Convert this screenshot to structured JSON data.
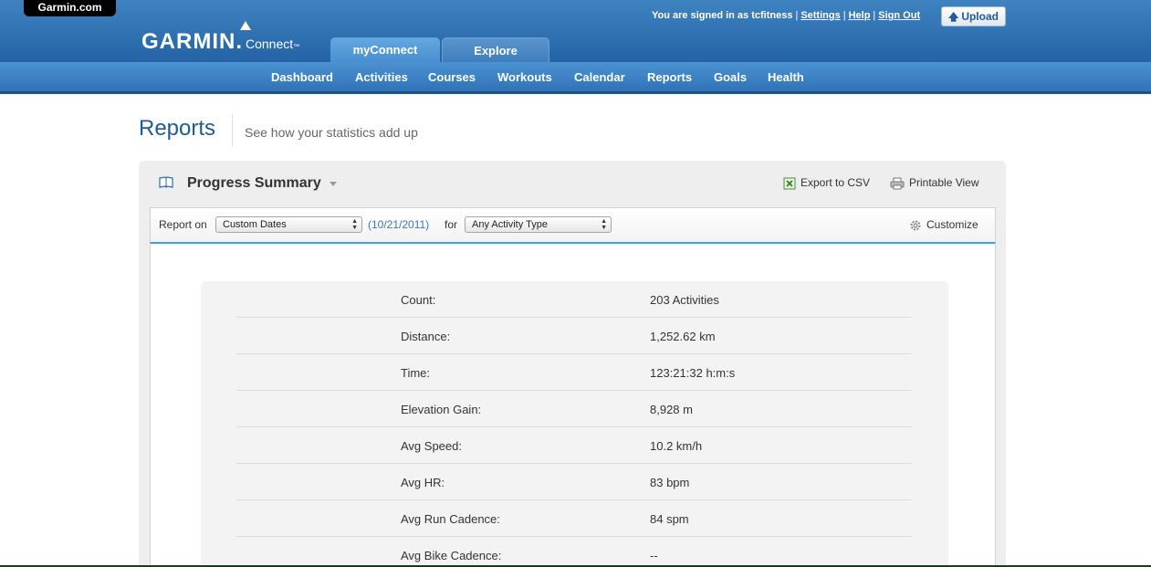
{
  "header": {
    "garmin_com": "Garmin.com",
    "logo_word": "GARMIN.",
    "logo_connect": "Connect",
    "logo_tm": "™",
    "signin_text": "You are signed in as tcfitness",
    "settings": "Settings",
    "help": "Help",
    "sign_out": "Sign Out",
    "separator": "|",
    "upload": "Upload"
  },
  "tabs": [
    {
      "label": "myConnect",
      "active": true
    },
    {
      "label": "Explore",
      "active": false
    }
  ],
  "subnav": [
    {
      "label": "Dashboard"
    },
    {
      "label": "Activities"
    },
    {
      "label": "Courses"
    },
    {
      "label": "Workouts"
    },
    {
      "label": "Calendar"
    },
    {
      "label": "Reports"
    },
    {
      "label": "Goals"
    },
    {
      "label": "Health"
    }
  ],
  "page": {
    "title": "Reports",
    "subtitle": "See how your statistics add up"
  },
  "panel": {
    "title": "Progress Summary",
    "export_csv": "Export to CSV",
    "printable_view": "Printable View"
  },
  "toolbar": {
    "report_on_label": "Report on",
    "report_on_value": "Custom Dates",
    "date": "(10/21/2011)",
    "for_label": "for",
    "activity_type_value": "Any Activity Type",
    "customize": "Customize"
  },
  "stats": [
    {
      "label": "Count:",
      "value": "203 Activities"
    },
    {
      "label": "Distance:",
      "value": "1,252.62 km"
    },
    {
      "label": "Time:",
      "value": "123:21:32 h:m:s"
    },
    {
      "label": "Elevation Gain:",
      "value": "8,928 m"
    },
    {
      "label": "Avg Speed:",
      "value": "10.2 km/h"
    },
    {
      "label": "Avg HR:",
      "value": "83 bpm"
    },
    {
      "label": "Avg Run Cadence:",
      "value": "84 spm"
    },
    {
      "label": "Avg Bike Cadence:",
      "value": "--"
    }
  ],
  "colors": {
    "header_blue": "#2666a8",
    "title_blue": "#1e5b93",
    "link_blue": "#3a77b9",
    "accent_line": "#35a9e8"
  }
}
